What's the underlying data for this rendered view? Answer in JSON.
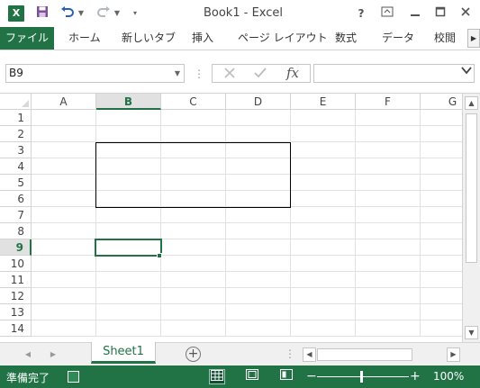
{
  "titlebar": {
    "app_icon_label": "X",
    "title": "Book1 - Excel",
    "help": "?",
    "buttons": [
      "help-icon",
      "ribbon-display-icon",
      "minimize-icon",
      "restore-icon",
      "close-icon"
    ]
  },
  "ribbon": {
    "tabs": [
      "ファイル",
      "ホーム",
      "新しいタブ",
      "挿入",
      "ページ レイアウト",
      "数式",
      "データ",
      "校閲"
    ]
  },
  "formula_bar": {
    "name_box": "B9",
    "formula": ""
  },
  "grid": {
    "columns": [
      "A",
      "B",
      "C",
      "D",
      "E",
      "F",
      "G"
    ],
    "rows": [
      "1",
      "2",
      "3",
      "4",
      "5",
      "6",
      "7",
      "8",
      "9",
      "10",
      "11",
      "12",
      "13",
      "14"
    ],
    "selected_column": "B",
    "selected_row": "9",
    "bordered_range": "B3:D6"
  },
  "sheets": {
    "tabs": [
      "Sheet1"
    ],
    "active": "Sheet1"
  },
  "status": {
    "text": "準備完了",
    "zoom": "100%",
    "zoom_minus": "−",
    "zoom_plus": "+"
  },
  "colors": {
    "accent": "#217346",
    "grid_line": "#e1e1e1",
    "header_selected_bg": "#e1e1e1"
  }
}
